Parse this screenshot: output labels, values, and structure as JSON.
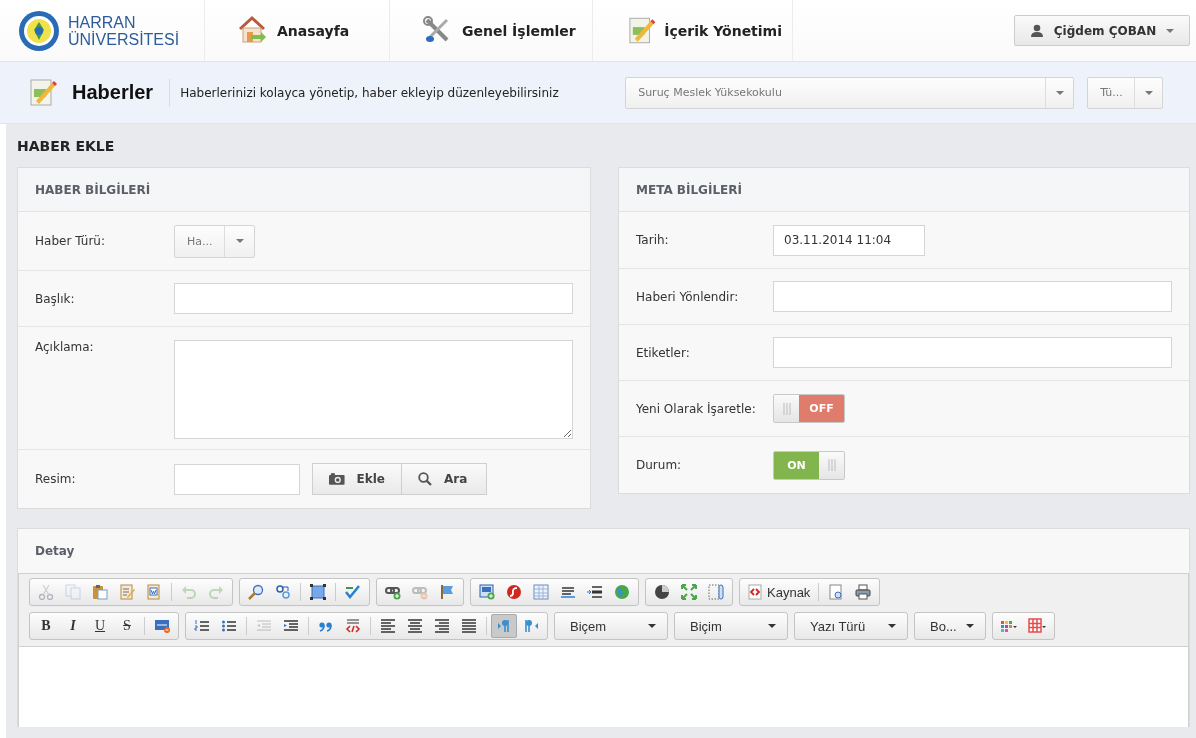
{
  "brand": {
    "line1": "HARRAN",
    "line2": "ÜNİVERSİTESİ"
  },
  "nav": [
    {
      "label": "Anasayfa",
      "kind": "home"
    },
    {
      "label": "Genel İşlemler",
      "kind": "tools"
    },
    {
      "label": "İçerik Yönetimi",
      "kind": "content"
    }
  ],
  "user": {
    "name": "Çiğdem ÇOBAN"
  },
  "page_header": {
    "title": "Haberler",
    "description": "Haberlerinizi kolayca yönetip, haber ekleyip düzenleyebilirsiniz",
    "unit_select": "Suruç Meslek Yüksekokulu",
    "filter_select": "Tü..."
  },
  "section_title": "HABER EKLE",
  "haber_bilgileri": {
    "title": "HABER BİLGİLERİ",
    "fields": [
      {
        "label": "Haber Türü:",
        "kind": "select",
        "value": "Ha..."
      },
      {
        "label": "Başlık:",
        "kind": "text"
      },
      {
        "label": "Açıklama:",
        "kind": "textarea"
      },
      {
        "label": "Resim:",
        "kind": "upload",
        "buttons": [
          {
            "label": "Ekle",
            "kind": "camera"
          },
          {
            "label": "Ara",
            "kind": "search"
          }
        ]
      }
    ]
  },
  "meta_bilgileri": {
    "title": "META BİLGİLERİ",
    "fields": [
      {
        "label": "Tarih:",
        "kind": "date",
        "value": "03.11.2014 11:04"
      },
      {
        "label": "Haberi Yönlendir:",
        "kind": "text"
      },
      {
        "label": "Etiketler:",
        "kind": "text"
      },
      {
        "label": "Yeni Olarak İşaretle:",
        "kind": "toggle",
        "on": false,
        "state_label": "OFF"
      },
      {
        "label": "Durum:",
        "kind": "toggle",
        "on": true,
        "state_label": "ON"
      }
    ]
  },
  "detay": {
    "title": "Detay",
    "toolbar_rows": [
      [
        [
          {
            "kind": "cut",
            "disabled": true
          },
          {
            "kind": "copy",
            "disabled": true
          },
          {
            "kind": "paste",
            "disabled": false
          },
          {
            "kind": "pastetext",
            "disabled": false
          },
          {
            "kind": "pasteword",
            "disabled": false
          },
          {
            "kind": "sep"
          },
          {
            "kind": "undo",
            "disabled": true
          },
          {
            "kind": "redo",
            "disabled": true
          }
        ],
        [
          {
            "kind": "find",
            "disabled": false
          },
          {
            "kind": "replace",
            "disabled": false
          },
          {
            "kind": "sep"
          },
          {
            "kind": "selectall",
            "disabled": false
          },
          {
            "kind": "sep"
          },
          {
            "kind": "spell",
            "disabled": false
          }
        ],
        [
          {
            "kind": "link",
            "disabled": false
          },
          {
            "kind": "unlink",
            "disabled": true
          },
          {
            "kind": "anchor",
            "disabled": false
          }
        ],
        [
          {
            "kind": "image",
            "disabled": false
          },
          {
            "kind": "flash",
            "disabled": false
          },
          {
            "kind": "table",
            "disabled": false
          },
          {
            "kind": "hrule",
            "disabled": false
          },
          {
            "kind": "pagebreak",
            "disabled": false
          },
          {
            "kind": "iframe",
            "disabled": false
          }
        ],
        [
          {
            "kind": "pie",
            "disabled": false
          },
          {
            "kind": "maximize",
            "disabled": false
          },
          {
            "kind": "showblocks",
            "disabled": false
          }
        ],
        [
          {
            "kind": "source",
            "label": "Kaynak",
            "disabled": false
          },
          {
            "kind": "sep"
          },
          {
            "kind": "preview",
            "disabled": false
          },
          {
            "kind": "print",
            "disabled": false
          }
        ]
      ],
      [
        [
          {
            "kind": "bold",
            "label": "B",
            "disabled": false
          },
          {
            "kind": "italic",
            "label": "I",
            "disabled": false
          },
          {
            "kind": "underline",
            "label": "U",
            "disabled": false
          },
          {
            "kind": "strike",
            "label": "S",
            "disabled": false
          },
          {
            "kind": "sep"
          },
          {
            "kind": "html",
            "disabled": false
          }
        ],
        [
          {
            "kind": "ol",
            "disabled": false
          },
          {
            "kind": "ul",
            "disabled": false
          },
          {
            "kind": "sep"
          },
          {
            "kind": "outdent",
            "disabled": true
          },
          {
            "kind": "indent",
            "disabled": false
          },
          {
            "kind": "sep"
          },
          {
            "kind": "quote",
            "disabled": false
          },
          {
            "kind": "div",
            "disabled": false
          },
          {
            "kind": "sep"
          },
          {
            "kind": "alignleft",
            "disabled": false
          },
          {
            "kind": "aligncenter",
            "disabled": false
          },
          {
            "kind": "alignright",
            "disabled": false
          },
          {
            "kind": "justify",
            "disabled": false
          },
          {
            "kind": "sep"
          },
          {
            "kind": "ltr",
            "disabled": false,
            "selected": true
          },
          {
            "kind": "rtl",
            "disabled": false,
            "selected": false
          }
        ],
        [
          {
            "kind": "combo",
            "label": "Biçem",
            "disabled": false
          }
        ],
        [
          {
            "kind": "combo",
            "label": "Biçim",
            "disabled": false
          }
        ],
        [
          {
            "kind": "combo",
            "label": "Yazı Türü",
            "disabled": false
          }
        ],
        [
          {
            "kind": "combo",
            "label": "Bo...",
            "disabled": false
          }
        ],
        [
          {
            "kind": "textcolor",
            "disabled": false
          },
          {
            "kind": "bgcolor",
            "disabled": false
          }
        ]
      ]
    ]
  }
}
